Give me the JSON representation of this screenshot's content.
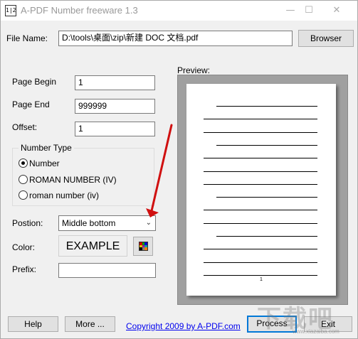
{
  "window": {
    "app_icon_text": "1|2",
    "title": "A-PDF Number freeware 1.3",
    "minimize": "—",
    "maximize": "☐",
    "close": "✕"
  },
  "file": {
    "label": "File Name:",
    "value": "D:\\tools\\桌面\\zip\\新建 DOC 文档.pdf",
    "browse_label": "Browser"
  },
  "page_begin": {
    "label": "Page Begin",
    "value": "1"
  },
  "page_end": {
    "label": "Page End",
    "value": "999999"
  },
  "offset": {
    "label": "Offset:",
    "value": "1"
  },
  "number_type": {
    "title": "Number Type",
    "options": [
      {
        "label": "Number",
        "checked": true
      },
      {
        "label": "ROMAN NUMBER (IV)",
        "checked": false
      },
      {
        "label": "roman number (iv)",
        "checked": false
      }
    ]
  },
  "position": {
    "label": "Postion:",
    "selected": "Middle bottom"
  },
  "color": {
    "label": "Color:",
    "example_text": "EXAMPLE",
    "palette": [
      "#d00000",
      "#00a000",
      "#0000d0",
      "#e0c000",
      "#a000a0",
      "#00a0a0",
      "#000000",
      "#808080",
      "#ff8000"
    ]
  },
  "prefix": {
    "label": "Prefix:",
    "value": ""
  },
  "preview": {
    "label": "Preview:",
    "page_number": "1"
  },
  "buttons": {
    "help": "Help",
    "more": "More ...",
    "process": "Process",
    "exit": "Exit"
  },
  "copyright_link": "Copyright 2009 by A-PDF.com",
  "watermark": {
    "main": "下载吧",
    "url": "www.xiazaiba.com"
  },
  "annotation_color": "#d01010"
}
